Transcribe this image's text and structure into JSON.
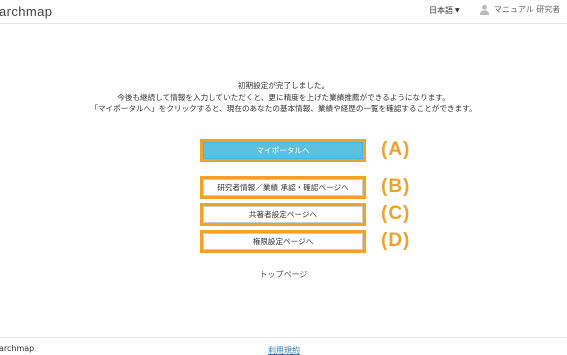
{
  "header": {
    "logo": "archmap",
    "language": "日本語",
    "user_name": "マニュアル 研究者"
  },
  "message": {
    "line1": "初期設定が完了しました。",
    "line2": "今後も継続して情報を入力していただくと、更に精度を上げた業績推薦ができるようになります。",
    "line3": "「マイポータルへ」をクリックすると、現在のあなたの基本情報、業績や経歴の一覧を確認することができます。"
  },
  "buttons": {
    "my_portal": "マイポータルへ",
    "researcher_info": "研究者情報／業績 承認・確認ページへ",
    "coauthor_settings": "共著者設定ページへ",
    "permission_settings": "権限設定ページへ"
  },
  "markers": {
    "a": "(A)",
    "b": "(B)",
    "c": "(C)",
    "d": "(D)"
  },
  "top_page_link": "トップページ",
  "footer": {
    "logo": "archmap",
    "terms_link": "利用規約"
  },
  "colors": {
    "annotation_orange": "#f0a22a",
    "primary_button": "#5bc0de",
    "link": "#337ab7"
  },
  "icons": {
    "user": "user-icon",
    "language_caret": "caret-down-icon"
  }
}
